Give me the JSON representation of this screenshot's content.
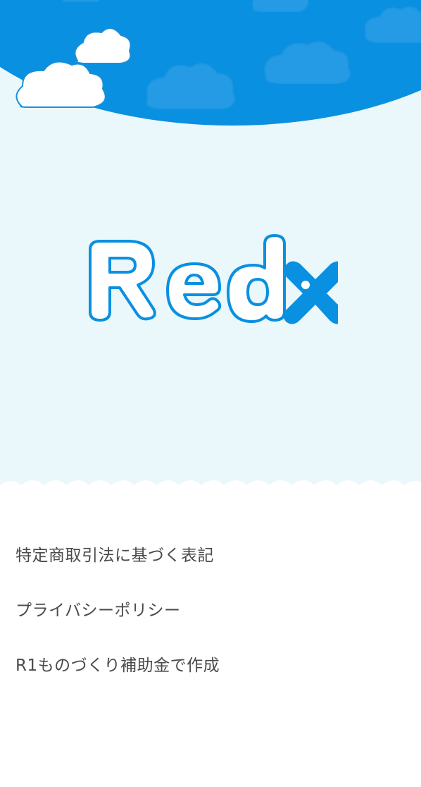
{
  "brand": {
    "logo_text": "Redx",
    "primary_color": "#0a90e0",
    "sky_color": "#eaf7fb"
  },
  "footer_links": [
    {
      "label": "特定商取引法に基づく表記"
    },
    {
      "label": "プライバシーポリシー"
    },
    {
      "label": "R1ものづくり補助金で作成"
    }
  ]
}
